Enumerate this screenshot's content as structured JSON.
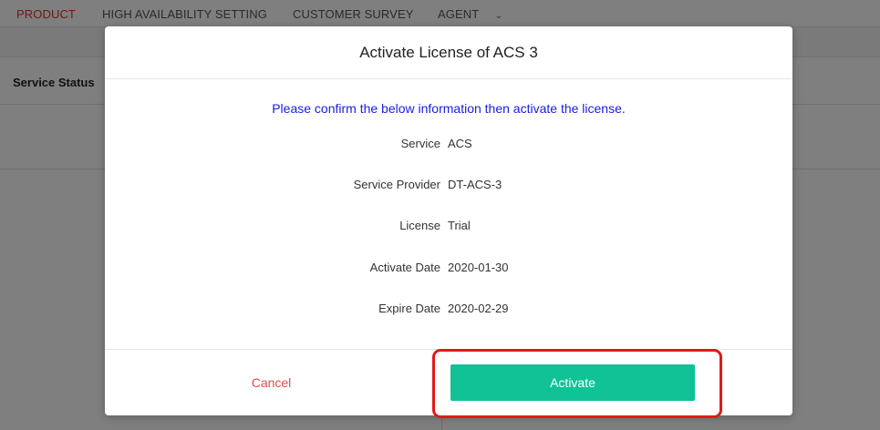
{
  "nav": {
    "items": [
      "PRODUCT",
      "HIGH AVAILABILITY SETTING",
      "CUSTOMER SURVEY",
      "AGENT"
    ]
  },
  "background": {
    "panel_title": "Service Status"
  },
  "modal": {
    "title": "Activate License of ACS 3",
    "confirm_text": "Please confirm the below information then activate the license.",
    "rows": [
      {
        "label": "Service",
        "value": "ACS"
      },
      {
        "label": "Service Provider",
        "value": "DT-ACS-3"
      },
      {
        "label": "License",
        "value": "Trial"
      },
      {
        "label": "Activate Date",
        "value": "2020-01-30"
      },
      {
        "label": "Expire Date",
        "value": "2020-02-29"
      }
    ],
    "cancel_label": "Cancel",
    "activate_label": "Activate"
  },
  "colors": {
    "accent": "#10c296",
    "cancel": "#e04b4b",
    "confirm_text": "#1a21e0",
    "highlight": "#e01a1a"
  }
}
